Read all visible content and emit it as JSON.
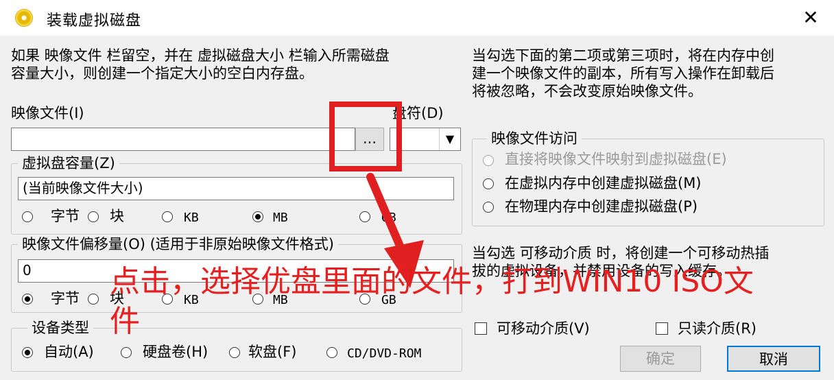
{
  "window": {
    "title": "装载虚拟磁盘",
    "close_icon": "close-icon"
  },
  "info": {
    "left_line1": "如果 映像文件 栏留空，并在 虚拟磁盘大小 栏输入所需磁盘",
    "left_line2": "容量大小，则创建一个指定大小的空白内存盘。",
    "right_line1": "当勾选下面的第二项或第三项时，将在内存中创",
    "right_line2": "建一个映像文件的副本，所有写入操作在卸载后",
    "right_line3": "将被忽略，不会改变原始映像文件。"
  },
  "image_file": {
    "label": "映像文件(I)",
    "value": "",
    "browse_label": "..."
  },
  "drive": {
    "label": "盘符(D)",
    "value": ""
  },
  "capacity": {
    "legend": "虚拟盘容量(Z)",
    "value": "(当前映像文件大小)",
    "units": [
      "字节",
      "块",
      "KB",
      "MB",
      "GB"
    ],
    "selected": "MB"
  },
  "offset": {
    "legend": "映像文件偏移量(O)  (适用于非原始映像文件格式)",
    "value": "0",
    "units": [
      "字节",
      "块",
      "KB",
      "MB",
      "GB"
    ],
    "selected": "字节"
  },
  "device_type": {
    "legend": "设备类型",
    "options": [
      "自动(A)",
      "硬盘卷(H)",
      "软盘(F)",
      "CD/DVD-ROM"
    ],
    "selected": "自动(A)"
  },
  "access": {
    "legend": "映像文件访问",
    "options": [
      "直接将映像文件映射到虚拟磁盘(E)",
      "在虚拟内存中创建虚拟磁盘(M)",
      "在物理内存中创建虚拟磁盘(P)"
    ]
  },
  "removable_info": {
    "line1": "当勾选 可移动介质 时，将创建一个可移动热插",
    "line2": "拔的虚拟设备，并禁用设备的写入缓存。"
  },
  "checks": {
    "removable": "可移动介质(V)",
    "readonly": "只读介质(R)"
  },
  "buttons": {
    "ok": "确定",
    "cancel": "取消"
  },
  "annotation": {
    "line1": "点击，选择优盘里面的文件，打到WIN10 ISO文",
    "line2": "件",
    "color": "#e62020"
  }
}
